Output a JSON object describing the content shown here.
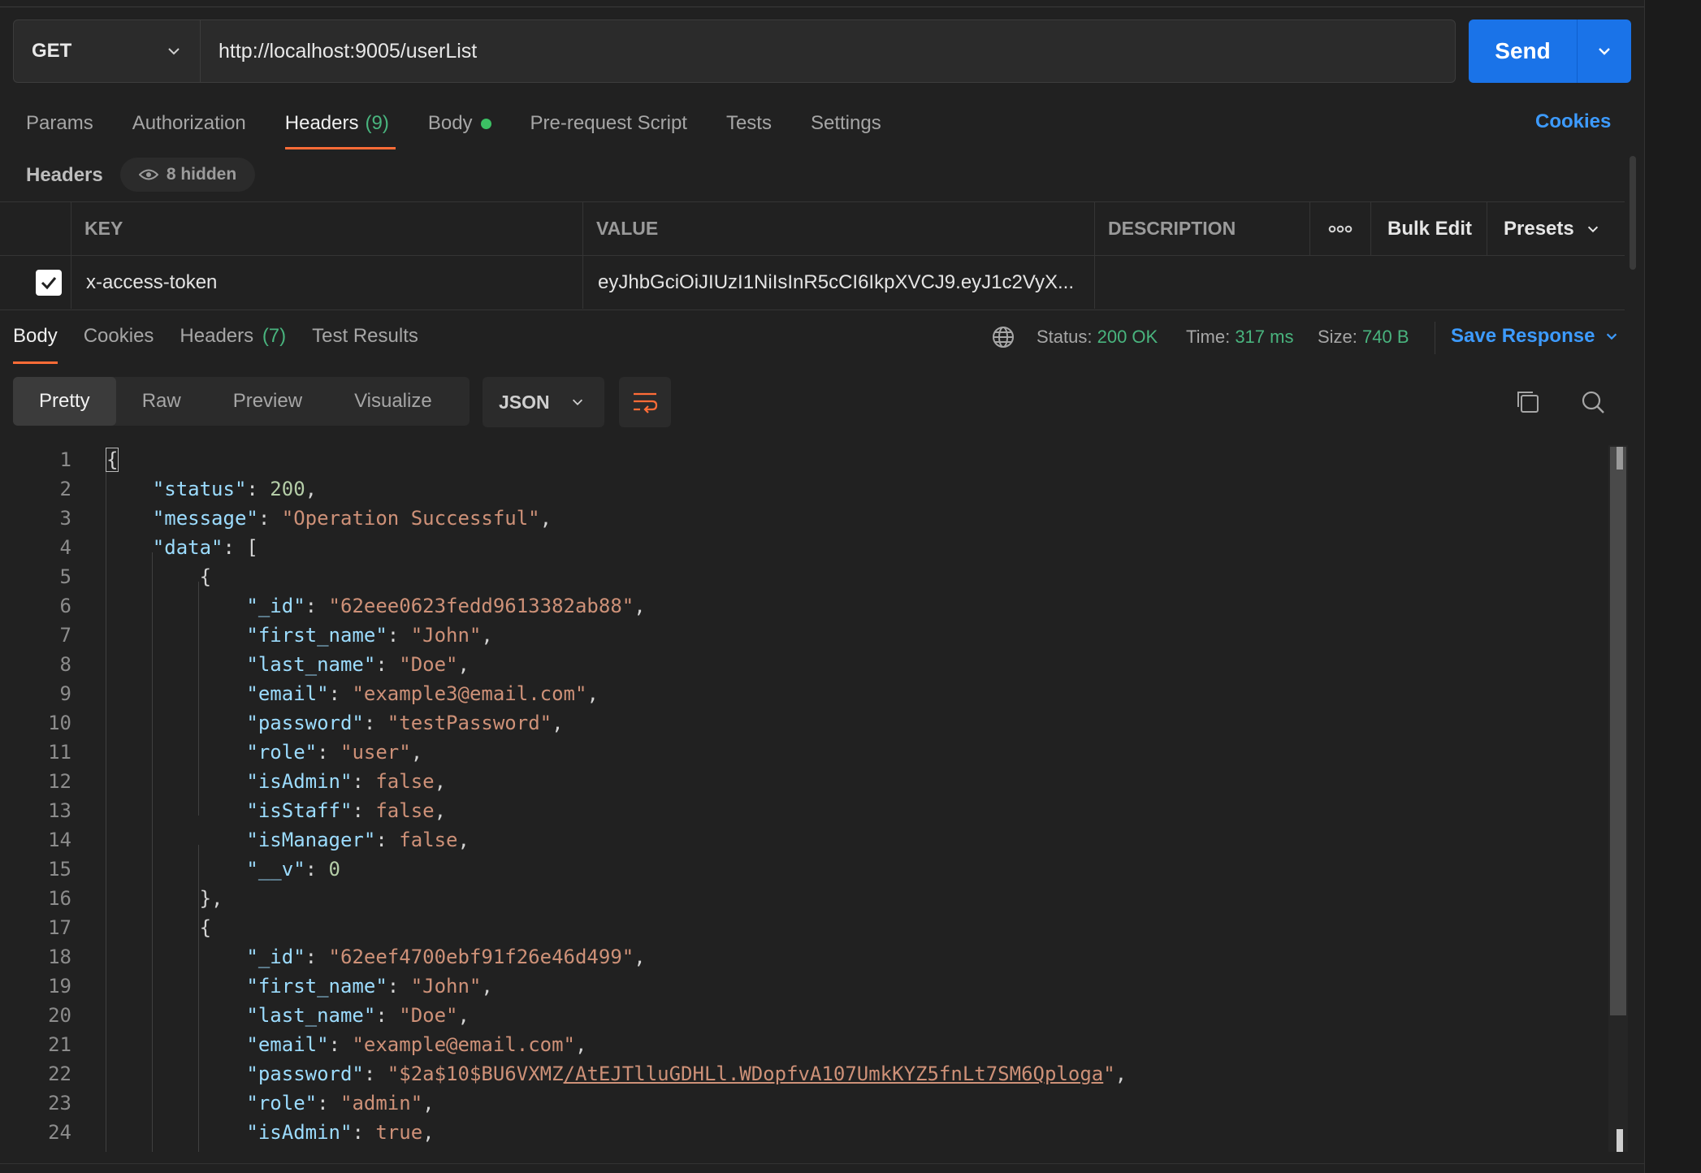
{
  "request": {
    "method": "GET",
    "url": "http://localhost:9005/userList",
    "send_label": "Send"
  },
  "request_tabs": [
    {
      "label": "Params"
    },
    {
      "label": "Authorization"
    },
    {
      "label": "Headers",
      "count": "(9)"
    },
    {
      "label": "Body"
    },
    {
      "label": "Pre-request Script"
    },
    {
      "label": "Tests"
    },
    {
      "label": "Settings"
    }
  ],
  "cookies_label": "Cookies",
  "headers_section": {
    "title": "Headers",
    "hidden_label": "8 hidden",
    "columns": {
      "key": "KEY",
      "value": "VALUE",
      "description": "DESCRIPTION"
    },
    "bulk_edit": "Bulk Edit",
    "presets": "Presets",
    "rows": [
      {
        "key": "x-access-token",
        "value": "eyJhbGciOiJIUzI1NiIsInR5cCI6IkpXVCJ9.eyJ1c2VyX..."
      }
    ]
  },
  "response": {
    "tabs": [
      {
        "label": "Body"
      },
      {
        "label": "Cookies"
      },
      {
        "label": "Headers",
        "count": "(7)"
      },
      {
        "label": "Test Results"
      }
    ],
    "status_label": "Status:",
    "status_value": "200 OK",
    "time_label": "Time:",
    "time_value": "317 ms",
    "size_label": "Size:",
    "size_value": "740 B",
    "save_label": "Save Response",
    "views": [
      "Pretty",
      "Raw",
      "Preview",
      "Visualize"
    ],
    "format": "JSON"
  },
  "code_lines": [
    "{",
    "    \"status\": 200,",
    "    \"message\": \"Operation Successful\",",
    "    \"data\": [",
    "        {",
    "            \"_id\": \"62eee0623fedd9613382ab88\",",
    "            \"first_name\": \"John\",",
    "            \"last_name\": \"Doe\",",
    "            \"email\": \"example3@email.com\",",
    "            \"password\": \"testPassword\",",
    "            \"role\": \"user\",",
    "            \"isAdmin\": false,",
    "            \"isStaff\": false,",
    "            \"isManager\": false,",
    "            \"__v\": 0",
    "        },",
    "        {",
    "            \"_id\": \"62eef4700ebf91f26e46d499\",",
    "            \"first_name\": \"John\",",
    "            \"last_name\": \"Doe\",",
    "            \"email\": \"example@email.com\",",
    "            \"password\": \"$2a$10$BU6VXMZ/AtEJTlluGDHLl.WDopfvA107UmkKYZ5fnLt7SM6Qploga\",",
    "            \"role\": \"admin\",",
    "            \"isAdmin\": true,"
  ],
  "colors": {
    "accent": "#ff6c37",
    "primary": "#1a73e8",
    "link": "#3d9bff",
    "success": "#49b47e"
  },
  "icons": {
    "globe": "globe-icon",
    "copy": "copy-icon",
    "search": "search-icon",
    "wrap": "wrap-lines-icon",
    "more": "more-icon"
  }
}
